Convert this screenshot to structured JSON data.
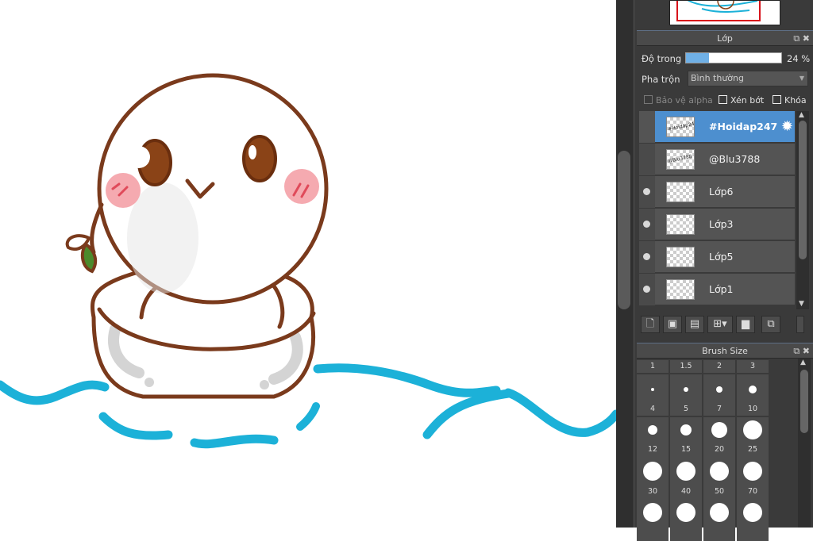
{
  "layer_panel": {
    "title": "Lớp",
    "opacity_label": "Độ trong",
    "opacity_value": "24 %",
    "opacity_fraction": 0.24,
    "blend_label": "Pha trộn",
    "blend_value": "Bình thường",
    "protect_alpha": "Bảo vệ alpha",
    "clip": "Xén bớt",
    "lock": "Khóa",
    "layers": [
      {
        "name": "#Hoidap247",
        "selected": true
      },
      {
        "name": "@Blu3788",
        "selected": false
      },
      {
        "name": "Lớp6",
        "selected": false
      },
      {
        "name": "Lớp3",
        "selected": false
      },
      {
        "name": "Lớp5",
        "selected": false
      },
      {
        "name": "Lớp1",
        "selected": false
      }
    ]
  },
  "brush_panel": {
    "title": "Brush Size",
    "top_sizes": [
      "1",
      "1.5",
      "2",
      "3"
    ],
    "sizes": [
      "4",
      "5",
      "7",
      "10",
      "12",
      "15",
      "20",
      "25",
      "30",
      "40",
      "50",
      "70"
    ]
  },
  "icons": {
    "gear": "gear-icon",
    "popout": "popout-icon",
    "close": "close-icon"
  },
  "colors": {
    "accent": "#4d8fcf",
    "water": "#1cb1d8",
    "outline": "#7a3a1c"
  }
}
